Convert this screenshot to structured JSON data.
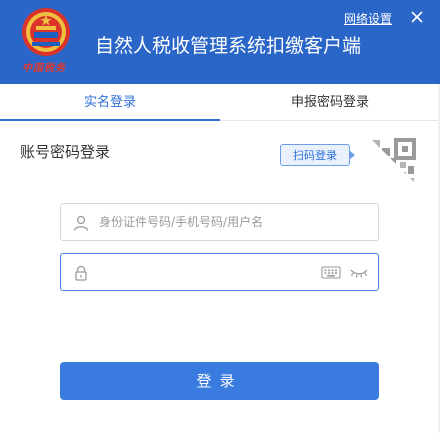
{
  "header": {
    "bureau_text": "中国税务",
    "app_title": "自然人税收管理系统扣缴客户端",
    "net_settings": "网络设置",
    "close_icon": "close-icon",
    "emblem_icon": "tax-emblem-icon"
  },
  "tabs": [
    {
      "label": "实名登录",
      "active": true
    },
    {
      "label": "申报密码登录",
      "active": false
    }
  ],
  "login": {
    "title": "账号密码登录",
    "scan_label": "扫码登录",
    "username_placeholder": "身份证件号码/手机号码/用户名",
    "username_value": "",
    "password_value": "",
    "submit_label": "登录"
  },
  "colors": {
    "header_bg": "#2a66c8",
    "accent": "#2f6fd6",
    "button_bg": "#3a7be0",
    "bureau_red": "#e03a2f"
  }
}
